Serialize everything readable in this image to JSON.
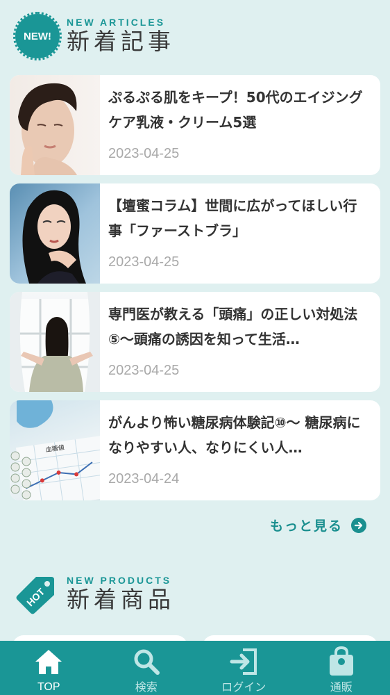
{
  "new_articles": {
    "badge": "NEW!",
    "title_en": "NEW ARTICLES",
    "title_ja": "新着記事",
    "items": [
      {
        "title": "ぷるぷる肌をキープ！50代のエイジングケア乳液・クリーム5選",
        "date": "2023-04-25"
      },
      {
        "title": "【壇蜜コラム】世間に広がってほしい行事「ファーストブラ」",
        "date": "2023-04-25"
      },
      {
        "title": "専門医が教える「頭痛」の正しい対処法⑤〜頭痛の誘因を知って生活…",
        "date": "2023-04-25"
      },
      {
        "title": "がんより怖い糖尿病体験記⑩〜 糖尿病になりやすい人、なりにくい人…",
        "date": "2023-04-24"
      }
    ],
    "more_label": "もっと見る"
  },
  "new_products": {
    "badge": "HOT",
    "title_en": "NEW PRODUCTS",
    "title_ja": "新着商品"
  },
  "thumb_text": {
    "chart_label": "血糖値"
  },
  "bottom_nav": [
    {
      "label": "TOP",
      "icon": "home-icon"
    },
    {
      "label": "検索",
      "icon": "search-icon"
    },
    {
      "label": "ログイン",
      "icon": "login-icon"
    },
    {
      "label": "通販",
      "icon": "shopping-bag-icon"
    }
  ],
  "colors": {
    "accent": "#1a9696",
    "background": "#dff0f0"
  }
}
